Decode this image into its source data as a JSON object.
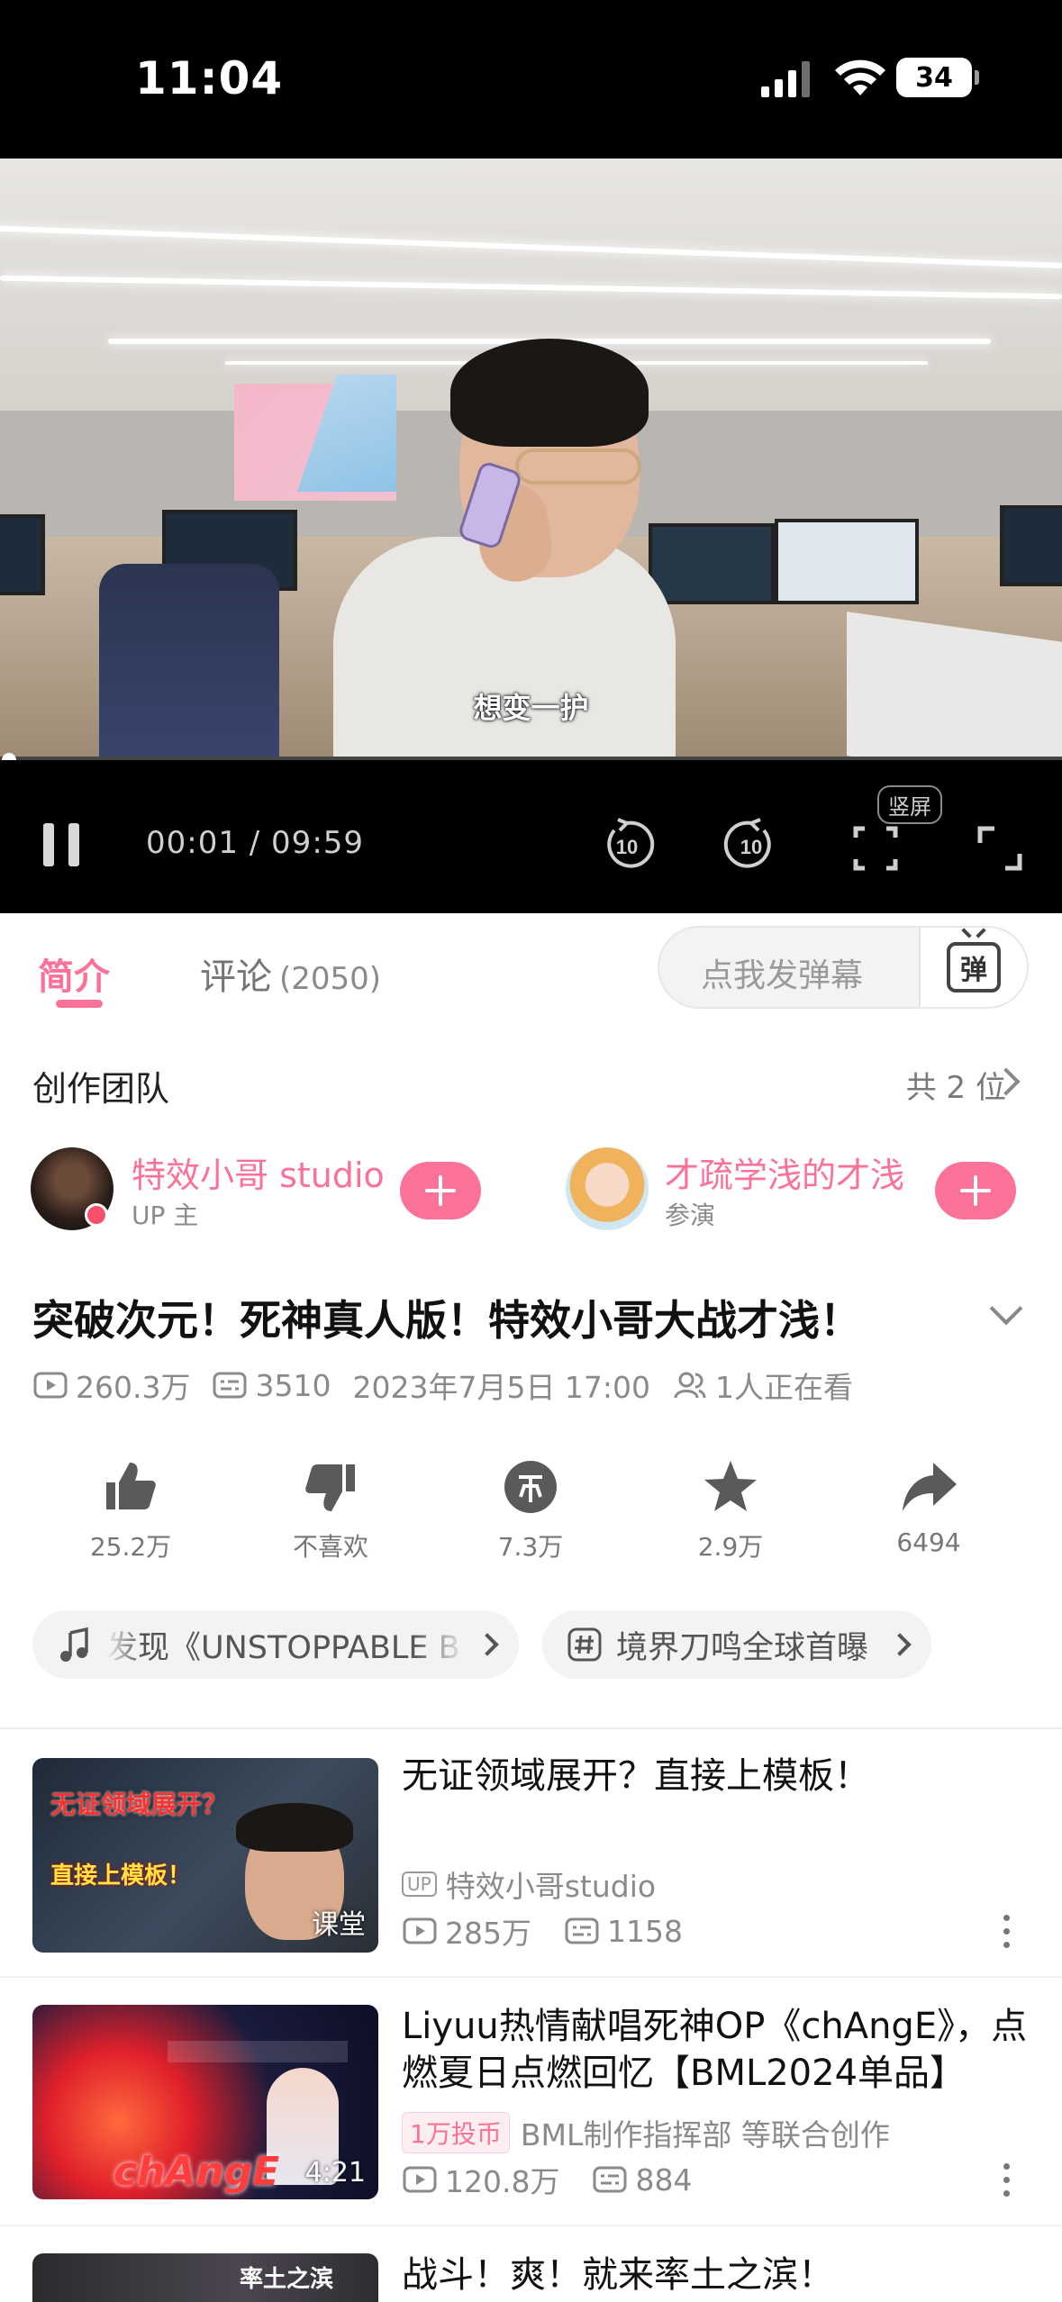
{
  "status_bar": {
    "time": "11:04",
    "battery": "34"
  },
  "player": {
    "subtitle": "想变一护",
    "time": "00:01 / 09:59",
    "progress_fraction": 0.002,
    "skip_back": "10",
    "skip_forward": "10",
    "vertical_label": "竖屏"
  },
  "tabs": {
    "intro": "简介",
    "comments": "评论",
    "comment_count": "(2050)"
  },
  "danmaku": {
    "placeholder": "点我发弹幕",
    "button": "弹"
  },
  "team": {
    "title": "创作团队",
    "total": "共 2 位",
    "members": [
      {
        "name": "特效小哥 studio",
        "role": "UP 主"
      },
      {
        "name": "才疏学浅的才浅",
        "role": "参演"
      }
    ]
  },
  "video": {
    "title": "突破次元！死神真人版！特效小哥大战才浅！",
    "views": "260.3万",
    "danmaku_count": "3510",
    "date": "2023年7月5日 17:00",
    "watching": "1人正在看"
  },
  "actions": [
    {
      "icon": "thumbs-up-icon",
      "label": "25.2万"
    },
    {
      "icon": "thumbs-down-icon",
      "label": "不喜欢"
    },
    {
      "icon": "coin-icon",
      "label": "7.3万"
    },
    {
      "icon": "star-icon",
      "label": "2.9万"
    },
    {
      "icon": "share-icon",
      "label": "6494"
    }
  ],
  "tags": [
    {
      "icon": "music-note-icon",
      "text": "发现《UNSTOPPABLE B"
    },
    {
      "icon": "hashtag-icon",
      "text": "境界刀鸣全球首曝"
    }
  ],
  "recommendations": [
    {
      "title": "无证领域展开？直接上模板！",
      "up_badge": "UP",
      "author": "特效小哥studio",
      "views": "285万",
      "danmaku": "1158",
      "thumb_badge": "课堂",
      "thumb_text_1": "无证领域展开？",
      "thumb_text_2": "直接上模板！"
    },
    {
      "title": "Liyuu热情献唱死神OP《chAngE》，点燃夏日点燃回忆【BML2024单品】",
      "coin_tag": "1万投币",
      "author": "BML制作指挥部 等联合创作",
      "views": "120.8万",
      "danmaku": "884",
      "thumb_badge": "4:21",
      "thumb_text_1": "chAngE"
    },
    {
      "title": "战斗！爽！就来率土之滨！",
      "thumb_text_1": "率土之滨"
    }
  ],
  "colors": {
    "accent": "#fb7299"
  }
}
